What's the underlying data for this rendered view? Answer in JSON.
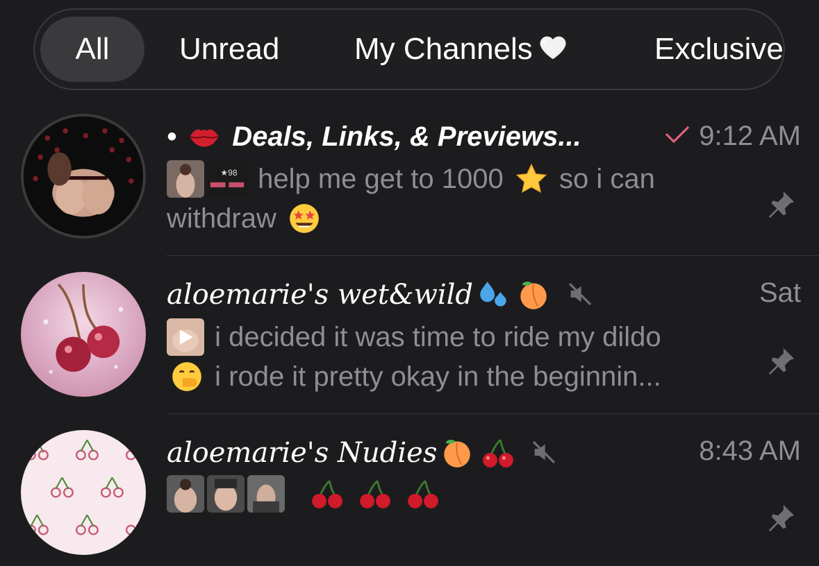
{
  "tabs": [
    {
      "label": "All",
      "active": true
    },
    {
      "label": "Unread",
      "active": false
    },
    {
      "label": "My Channels",
      "active": false,
      "icon": "white-heart-icon"
    },
    {
      "label": "Exclusive",
      "active": false
    }
  ],
  "chats": [
    {
      "title_prefix": "•",
      "title": "Deals, Links, & Previews...",
      "title_icon": "kiss-lips-icon",
      "time": "9:12 AM",
      "read": true,
      "preview_line1": "help me get to 1000",
      "preview_mid": "so i can",
      "preview_line2": "withdraw",
      "thumb_badge": "★98",
      "pinned": true
    },
    {
      "title": "aloemarie's wet&wild",
      "time": "Sat",
      "muted": true,
      "preview_line1": "i decided it was time to ride my dildo",
      "preview_line2": "i rode it pretty okay in the beginnin...",
      "pinned": true
    },
    {
      "title": "aloemarie's Nudies",
      "time": "8:43 AM",
      "muted": true,
      "pinned": true
    }
  ],
  "colors": {
    "background": "#1c1c1e",
    "secondary_text": "#8e8e93",
    "read_check": "#e2637c",
    "tab_active": "#3a3a3c"
  }
}
